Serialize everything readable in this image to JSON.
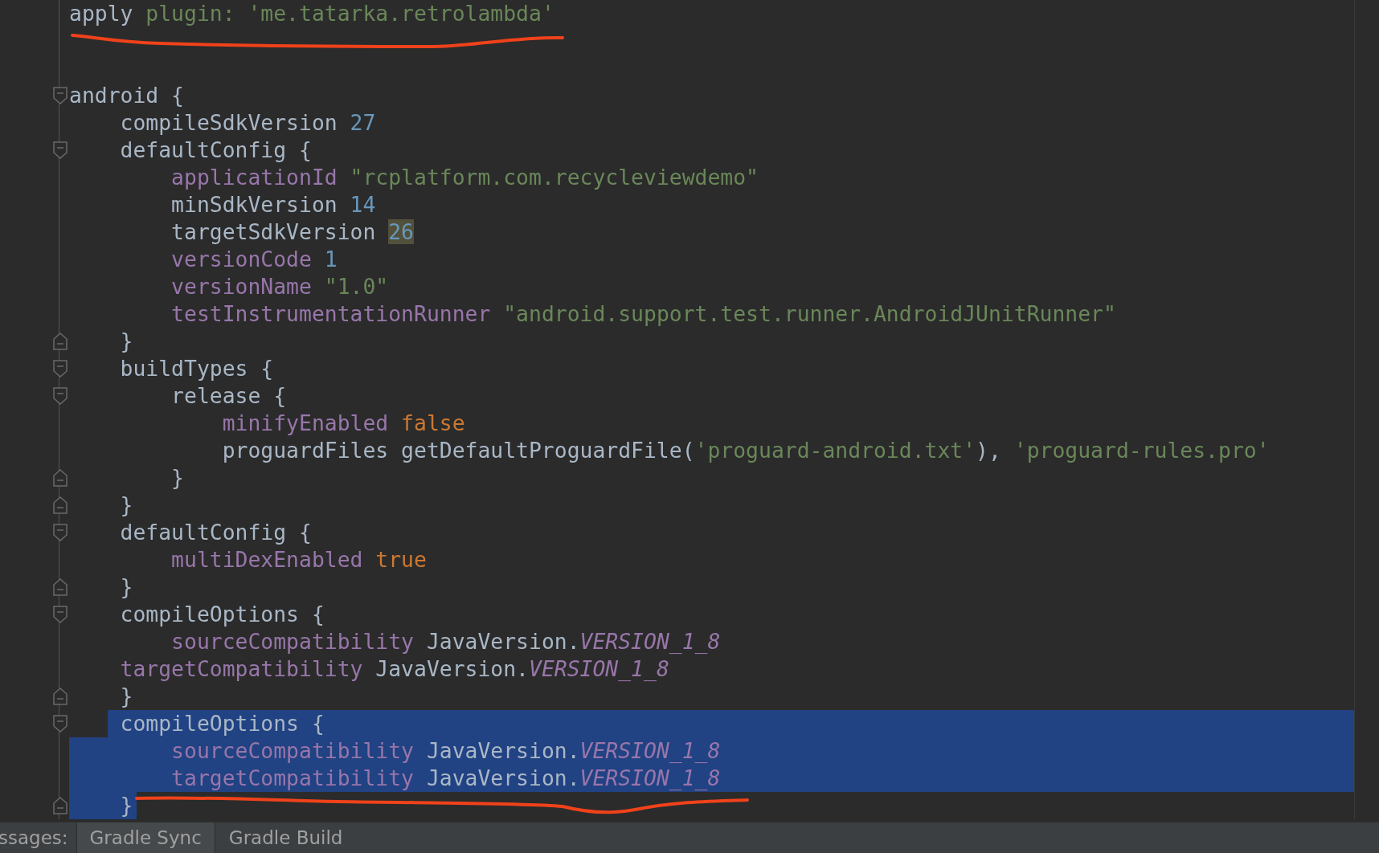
{
  "editor": {
    "lines": [
      {
        "kind": "code",
        "selected": false,
        "tokens": [
          {
            "kind": "plain",
            "text": "apply "
          },
          {
            "kind": "string",
            "text": "plugin: 'me.tatarka.retrolambda'"
          }
        ]
      },
      {
        "kind": "blank",
        "selected": false
      },
      {
        "kind": "blank",
        "selected": false
      },
      {
        "kind": "code",
        "selected": false,
        "fold_start": true,
        "tokens": [
          {
            "kind": "plain",
            "text": "android {"
          }
        ]
      },
      {
        "kind": "code",
        "selected": false,
        "tokens": [
          {
            "kind": "plain",
            "text": "    compileSdkVersion "
          },
          {
            "kind": "number",
            "text": "27"
          }
        ]
      },
      {
        "kind": "code",
        "selected": false,
        "fold_start": true,
        "tokens": [
          {
            "kind": "plain",
            "text": "    defaultConfig {"
          }
        ]
      },
      {
        "kind": "code",
        "selected": false,
        "tokens": [
          {
            "kind": "keyword",
            "text": "        applicationId "
          },
          {
            "kind": "string",
            "text": "\"rcplatform.com.recycleviewdemo\""
          }
        ]
      },
      {
        "kind": "code",
        "selected": false,
        "tokens": [
          {
            "kind": "plain",
            "text": "        minSdkVersion "
          },
          {
            "kind": "number",
            "text": "14"
          }
        ]
      },
      {
        "kind": "code",
        "selected": false,
        "tokens": [
          {
            "kind": "plain",
            "text": "        targetSdkVersion "
          },
          {
            "kind": "number_marked",
            "text": "26"
          }
        ]
      },
      {
        "kind": "code",
        "selected": false,
        "tokens": [
          {
            "kind": "keyword",
            "text": "        versionCode "
          },
          {
            "kind": "number",
            "text": "1"
          }
        ]
      },
      {
        "kind": "code",
        "selected": false,
        "tokens": [
          {
            "kind": "keyword",
            "text": "        versionName "
          },
          {
            "kind": "string",
            "text": "\"1.0\""
          }
        ]
      },
      {
        "kind": "code",
        "selected": false,
        "tokens": [
          {
            "kind": "keyword",
            "text": "        testInstrumentationRunner "
          },
          {
            "kind": "string",
            "text": "\"android.support.test.runner.AndroidJUnitRunner\""
          }
        ]
      },
      {
        "kind": "code",
        "selected": false,
        "fold_end": true,
        "tokens": [
          {
            "kind": "plain",
            "text": "    }"
          }
        ]
      },
      {
        "kind": "code",
        "selected": false,
        "fold_start": true,
        "tokens": [
          {
            "kind": "plain",
            "text": "    buildTypes {"
          }
        ]
      },
      {
        "kind": "code",
        "selected": false,
        "fold_start": true,
        "tokens": [
          {
            "kind": "plain",
            "text": "        release {"
          }
        ]
      },
      {
        "kind": "code",
        "selected": false,
        "tokens": [
          {
            "kind": "keyword",
            "text": "            minifyEnabled "
          },
          {
            "kind": "bool",
            "text": "false"
          }
        ]
      },
      {
        "kind": "code",
        "selected": false,
        "tokens": [
          {
            "kind": "plain",
            "text": "            proguardFiles getDefaultProguardFile("
          },
          {
            "kind": "string",
            "text": "'proguard-android.txt'"
          },
          {
            "kind": "plain",
            "text": "), "
          },
          {
            "kind": "string",
            "text": "'proguard-rules.pro'"
          }
        ]
      },
      {
        "kind": "code",
        "selected": false,
        "fold_end": true,
        "tokens": [
          {
            "kind": "plain",
            "text": "        }"
          }
        ]
      },
      {
        "kind": "code",
        "selected": false,
        "fold_end": true,
        "tokens": [
          {
            "kind": "plain",
            "text": "    }"
          }
        ]
      },
      {
        "kind": "code",
        "selected": false,
        "fold_start": true,
        "tokens": [
          {
            "kind": "plain",
            "text": "    defaultConfig {"
          }
        ]
      },
      {
        "kind": "code",
        "selected": false,
        "tokens": [
          {
            "kind": "keyword",
            "text": "        multiDexEnabled "
          },
          {
            "kind": "bool",
            "text": "true"
          }
        ]
      },
      {
        "kind": "code",
        "selected": false,
        "fold_end": true,
        "tokens": [
          {
            "kind": "plain",
            "text": "    }"
          }
        ]
      },
      {
        "kind": "code",
        "selected": false,
        "fold_start": true,
        "tokens": [
          {
            "kind": "plain",
            "text": "    compileOptions {"
          }
        ]
      },
      {
        "kind": "code",
        "selected": false,
        "tokens": [
          {
            "kind": "keyword",
            "text": "        sourceCompatibility "
          },
          {
            "kind": "plain",
            "text": "JavaVersion."
          },
          {
            "kind": "constant",
            "text": "VERSION_1_8"
          }
        ]
      },
      {
        "kind": "code",
        "selected": false,
        "tokens": [
          {
            "kind": "keyword",
            "text": "    targetCompatibility "
          },
          {
            "kind": "plain",
            "text": "JavaVersion."
          },
          {
            "kind": "constant",
            "text": "VERSION_1_8"
          }
        ]
      },
      {
        "kind": "code",
        "selected": false,
        "fold_end": true,
        "tokens": [
          {
            "kind": "plain",
            "text": "    }"
          }
        ]
      },
      {
        "kind": "code",
        "selected": true,
        "fold_start": true,
        "tokens": [
          {
            "kind": "plain",
            "text": "    compileOptions {"
          }
        ]
      },
      {
        "kind": "code",
        "selected": true,
        "tokens": [
          {
            "kind": "keyword",
            "text": "        sourceCompatibility "
          },
          {
            "kind": "plain",
            "text": "JavaVersion."
          },
          {
            "kind": "constant",
            "text": "VERSION_1_8"
          }
        ]
      },
      {
        "kind": "code",
        "selected": true,
        "tokens": [
          {
            "kind": "keyword",
            "text": "        targetCompatibility "
          },
          {
            "kind": "plain",
            "text": "JavaVersion."
          },
          {
            "kind": "constant",
            "text": "VERSION_1_8"
          }
        ]
      },
      {
        "kind": "code",
        "selected": true,
        "fold_end": true,
        "tokens": [
          {
            "kind": "plain",
            "text": "    }"
          }
        ]
      }
    ]
  },
  "bottom_bar": {
    "label": "ssages:",
    "tabs": [
      {
        "label": "Gradle Sync",
        "selected": true
      },
      {
        "label": "Gradle Build",
        "selected": false
      }
    ]
  }
}
